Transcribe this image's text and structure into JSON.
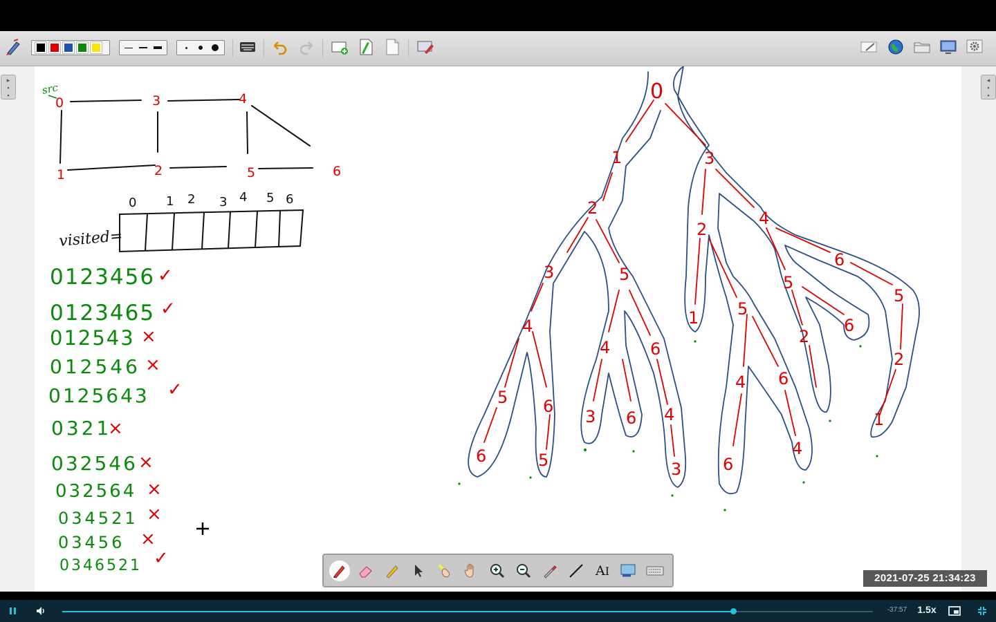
{
  "window": {
    "title": ""
  },
  "toolbar": {
    "colors": [
      "#000000",
      "#e00000",
      "#1f4fb3",
      "#0a8a0a",
      "#f5e500"
    ],
    "line_widths": [
      "thin",
      "medium",
      "thick"
    ],
    "dot_sizes": [
      "small",
      "medium",
      "large"
    ],
    "left_icons": [
      "pen-tool-icon",
      "keyboard-icon",
      "undo-icon",
      "redo-icon",
      "new-page-icon",
      "page-icon",
      "blank-page-icon",
      "screen-capture-icon"
    ],
    "right_icons": [
      "edit-icon",
      "globe-icon",
      "folder-icon",
      "display-icon",
      "settings-icon"
    ]
  },
  "whiteboard": {
    "graph": {
      "src_label": "src",
      "nodes": [
        "0",
        "1",
        "2",
        "3",
        "4",
        "5",
        "6"
      ]
    },
    "visited": {
      "label": "visited=",
      "indices": [
        "0",
        "1",
        "2",
        "3",
        "4",
        "5",
        "6"
      ]
    },
    "paths": [
      {
        "text": "0123456",
        "mark": "✓"
      },
      {
        "text": "0123465",
        "mark": "✓"
      },
      {
        "text": "012543",
        "mark": "×"
      },
      {
        "text": "012546",
        "mark": "×"
      },
      {
        "text": "0125643",
        "mark": "✓"
      },
      {
        "text": "0321",
        "mark": "×"
      },
      {
        "text": "032546",
        "mark": "×"
      },
      {
        "text": "032564",
        "mark": "×"
      },
      {
        "text": "034521",
        "mark": "×"
      },
      {
        "text": "03456",
        "mark": "×"
      },
      {
        "text": "0346521",
        "mark": "✓"
      }
    ],
    "tree_labels": {
      "root": "0",
      "level1": [
        "1",
        "3"
      ],
      "left_subtree": [
        "2",
        "3",
        "5",
        "4",
        "4",
        "6",
        "5",
        "6",
        "6",
        "5",
        "3",
        "6",
        "4",
        "3"
      ],
      "right_subtree": [
        "2",
        "4",
        "1",
        "5",
        "4",
        "6",
        "6",
        "5",
        "2",
        "6",
        "2",
        "4",
        "1"
      ]
    }
  },
  "bottom_tools": [
    "pen-icon",
    "eraser-icon",
    "highlighter-icon",
    "pointer-icon",
    "laser-pointer-icon",
    "hand-icon",
    "zoom-in-icon",
    "zoom-out-icon",
    "dropper-icon",
    "line-icon",
    "text-icon",
    "screenshot-icon",
    "keyboard-icon"
  ],
  "bottom_tools_text_label": "A",
  "timestamp": "2021-07-25  21:34:23",
  "player": {
    "time_remaining": "-37:57",
    "speed": "1.5x",
    "progress": 0.828
  }
}
